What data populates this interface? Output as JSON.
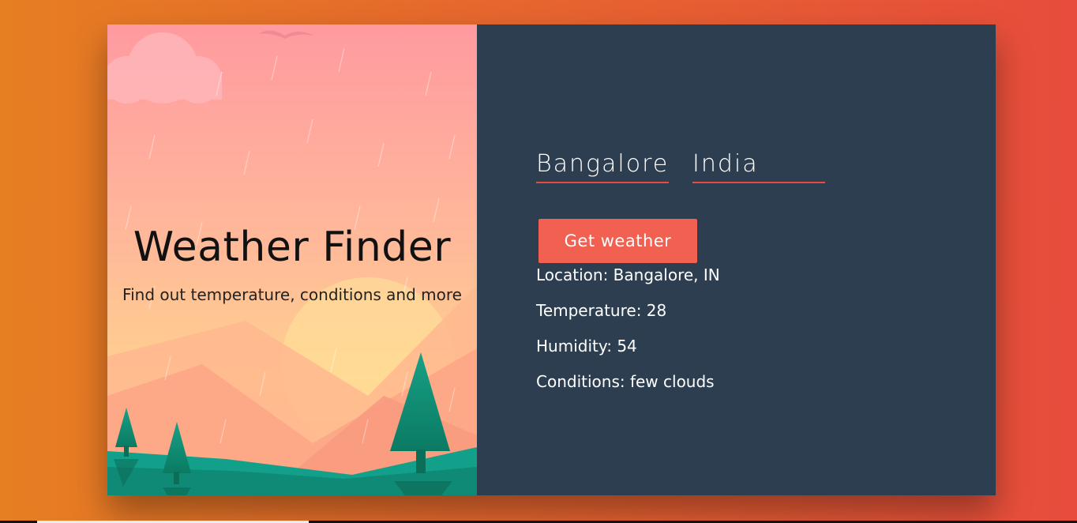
{
  "hero": {
    "title": "Weather Finder",
    "subtitle": "Find out temperature, conditions and more"
  },
  "form": {
    "city_value": "Bangalore",
    "country_value": "India",
    "submit_label": "Get weather"
  },
  "results": {
    "location": "Location: Bangalore, IN",
    "temperature": "Temperature: 28",
    "humidity": "Humidity: 54",
    "conditions": "Conditions: few clouds"
  },
  "colors": {
    "page_gradient_start": "#e67e22",
    "page_gradient_end": "#e74c3c",
    "panel": "#2c3e50",
    "accent": "#f16051"
  }
}
